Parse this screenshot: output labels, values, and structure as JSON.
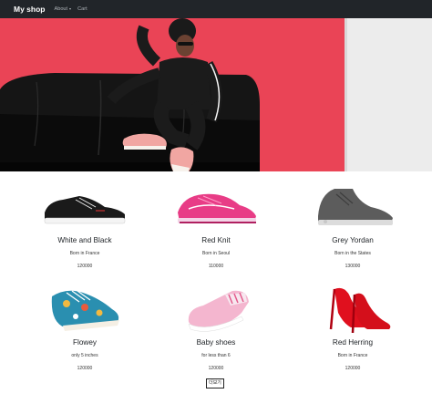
{
  "navbar": {
    "brand": "My shop",
    "about_label": "About",
    "cart_label": "Cart"
  },
  "hero": {
    "background_color": "#ea4456",
    "wall_right_color": "#ececec",
    "sofa_color": "#141414"
  },
  "products": [
    {
      "name": "White and Black",
      "desc": "Born in France",
      "price": "120000",
      "icon": "black-sneaker-icon"
    },
    {
      "name": "Red Knit",
      "desc": "Born in Seoul",
      "price": "110000",
      "icon": "pink-running-shoe-icon"
    },
    {
      "name": "Grey Yordan",
      "desc": "Born in the States",
      "price": "130000",
      "icon": "grey-high-top-icon"
    },
    {
      "name": "Flowey",
      "desc": "only 5 inches",
      "price": "120000",
      "icon": "floral-sneaker-icon"
    },
    {
      "name": "Baby shoes",
      "desc": "for less than 6",
      "price": "120000",
      "icon": "pink-slip-on-icon"
    },
    {
      "name": "Red Herring",
      "desc": "Born in France",
      "price": "120000",
      "icon": "red-heel-icon"
    }
  ],
  "more_button_label": "더보기"
}
